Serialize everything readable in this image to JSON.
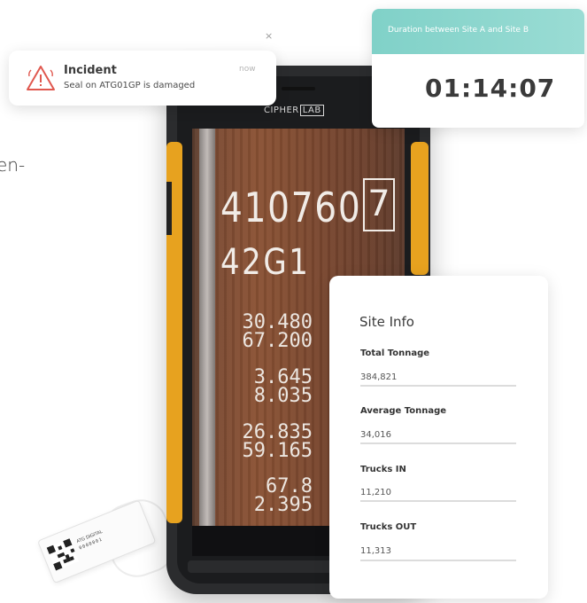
{
  "clipped_text": "en-",
  "phone": {
    "brand": "CIPHER",
    "brand_suffix": "LAB",
    "container": {
      "number": "410760",
      "check_digit": "7",
      "type_code": "42G1",
      "weights": [
        [
          "30.480",
          "67.200"
        ],
        [
          "3.645",
          "8.035"
        ],
        [
          "26.835",
          "59.165"
        ],
        [
          "67.8",
          "2.395"
        ]
      ]
    }
  },
  "incident": {
    "title": "Incident",
    "message": "Seal on ATG01GP is damaged",
    "time": "now",
    "close": "×",
    "icon": "warning-icon",
    "accent": "#e0584f"
  },
  "duration": {
    "label": "Duration between Site A and Site B",
    "value": "01:14:07",
    "accent": "#8fd7ce"
  },
  "site_info": {
    "title": "Site Info",
    "fields": [
      {
        "label": "Total Tonnage",
        "value": "384,821"
      },
      {
        "label": "Average Tonnage",
        "value": "34,016"
      },
      {
        "label": "Trucks IN",
        "value": "11,210"
      },
      {
        "label": "Trucks OUT",
        "value": "11,313"
      }
    ]
  },
  "seal": {
    "brand": "ATG DIGITAL",
    "serial": "0000001"
  }
}
